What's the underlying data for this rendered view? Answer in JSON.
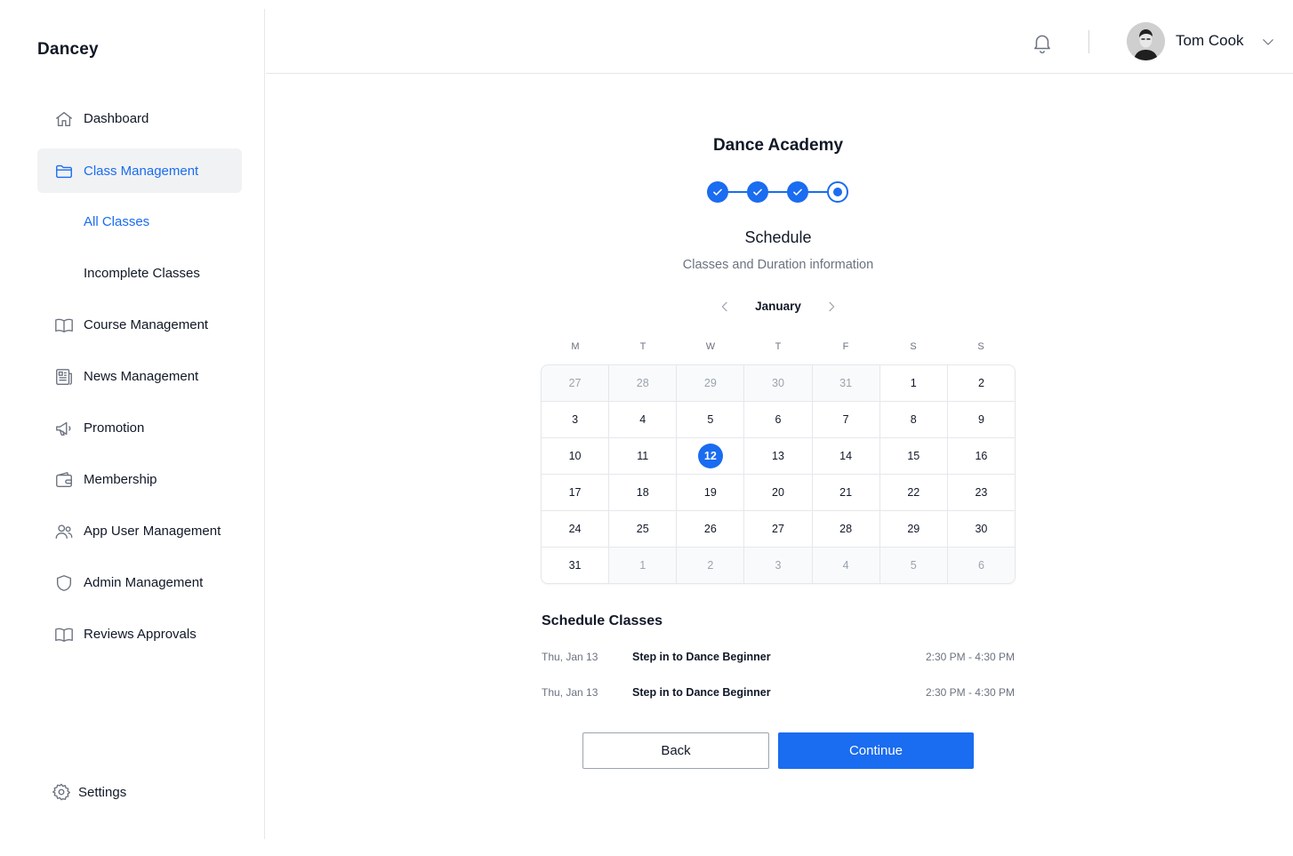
{
  "app": {
    "brand": "Dancey"
  },
  "sidebar": {
    "items": [
      {
        "label": "Dashboard",
        "icon": "home-icon"
      },
      {
        "label": "Class Management",
        "icon": "folder-icon",
        "active": true
      },
      {
        "label": "All Classes",
        "sub": true,
        "selected": true
      },
      {
        "label": "Incomplete Classes",
        "sub": true
      },
      {
        "label": "Course Management",
        "icon": "book-open-icon"
      },
      {
        "label": "News Management",
        "icon": "newspaper-icon"
      },
      {
        "label": "Promotion",
        "icon": "megaphone-icon"
      },
      {
        "label": "Membership",
        "icon": "wallet-icon"
      },
      {
        "label": "App User Management",
        "icon": "users-icon"
      },
      {
        "label": "Admin Management",
        "icon": "shield-icon"
      },
      {
        "label": "Reviews Approvals",
        "icon": "book-open-icon"
      }
    ],
    "settings_label": "Settings"
  },
  "header": {
    "user_name": "Tom Cook"
  },
  "main": {
    "title": "Dance Academy",
    "steps": [
      {
        "state": "complete"
      },
      {
        "state": "complete"
      },
      {
        "state": "complete"
      },
      {
        "state": "current"
      }
    ],
    "section_title": "Schedule",
    "section_subtitle": "Classes and Duration information",
    "calendar": {
      "month": "January",
      "weekdays": [
        "M",
        "T",
        "W",
        "T",
        "F",
        "S",
        "S"
      ],
      "days": [
        {
          "d": "27",
          "muted": true
        },
        {
          "d": "28",
          "muted": true
        },
        {
          "d": "29",
          "muted": true
        },
        {
          "d": "30",
          "muted": true
        },
        {
          "d": "31",
          "muted": true
        },
        {
          "d": "1"
        },
        {
          "d": "2"
        },
        {
          "d": "3"
        },
        {
          "d": "4"
        },
        {
          "d": "5"
        },
        {
          "d": "6"
        },
        {
          "d": "7"
        },
        {
          "d": "8"
        },
        {
          "d": "9"
        },
        {
          "d": "10"
        },
        {
          "d": "11"
        },
        {
          "d": "12",
          "selected": true
        },
        {
          "d": "13"
        },
        {
          "d": "14"
        },
        {
          "d": "15"
        },
        {
          "d": "16"
        },
        {
          "d": "17"
        },
        {
          "d": "18"
        },
        {
          "d": "19"
        },
        {
          "d": "20"
        },
        {
          "d": "21"
        },
        {
          "d": "22"
        },
        {
          "d": "23"
        },
        {
          "d": "24"
        },
        {
          "d": "25"
        },
        {
          "d": "26"
        },
        {
          "d": "27"
        },
        {
          "d": "28"
        },
        {
          "d": "29"
        },
        {
          "d": "30"
        },
        {
          "d": "31"
        },
        {
          "d": "1",
          "muted": true
        },
        {
          "d": "2",
          "muted": true
        },
        {
          "d": "3",
          "muted": true
        },
        {
          "d": "4",
          "muted": true
        },
        {
          "d": "5",
          "muted": true
        },
        {
          "d": "6",
          "muted": true
        }
      ]
    },
    "schedule_title": "Schedule Classes",
    "schedule": [
      {
        "date": "Thu, Jan 13",
        "name": "Step in to Dance Beginner",
        "time": "2:30 PM - 4:30 PM"
      },
      {
        "date": "Thu, Jan 13",
        "name": "Step in to Dance Beginner",
        "time": "2:30 PM - 4:30 PM"
      }
    ],
    "back_label": "Back",
    "continue_label": "Continue"
  },
  "colors": {
    "accent": "#1a6cf0",
    "border": "#e5e7eb",
    "muted_text": "#6b7280"
  }
}
